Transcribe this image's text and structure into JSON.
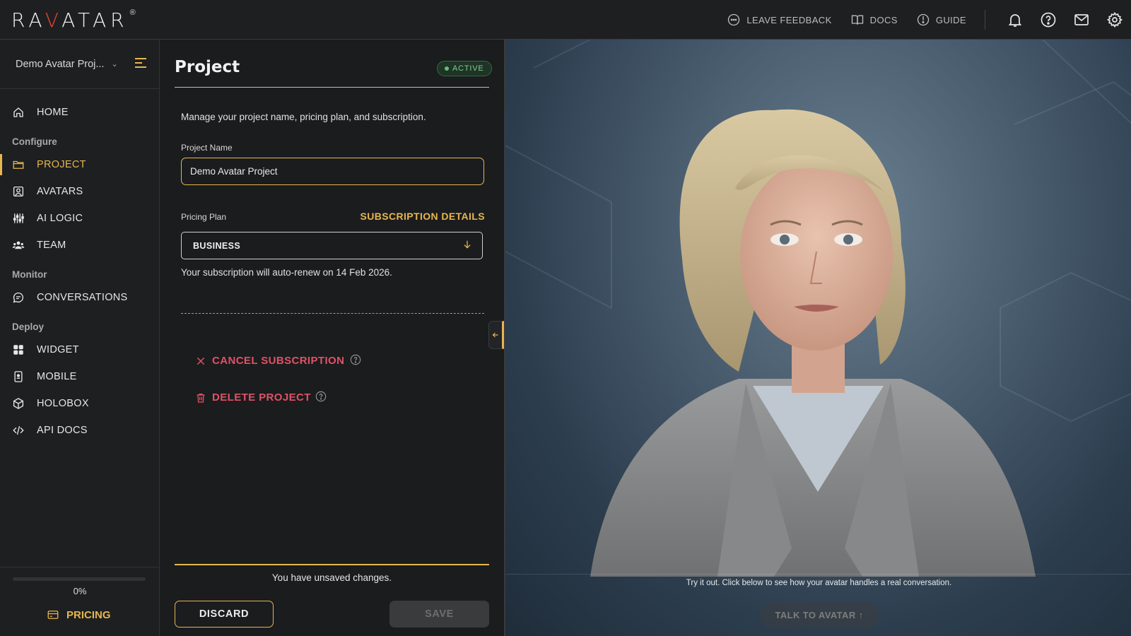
{
  "brand": {
    "logo_text_left": "RA",
    "logo_text_accent": "V",
    "logo_text_mid": "ATAR",
    "logo_reg": "®"
  },
  "topbar": {
    "leave_feedback": "LEAVE FEEDBACK",
    "docs": "DOCS",
    "guide": "GUIDE"
  },
  "sidebar": {
    "project_name": "Demo Avatar Proj...",
    "nav": {
      "home": "HOME",
      "section_configure": "Configure",
      "project": "PROJECT",
      "avatars": "AVATARS",
      "ai_logic": "AI LOGIC",
      "team": "TEAM",
      "section_monitor": "Monitor",
      "conversations": "CONVERSATIONS",
      "section_deploy": "Deploy",
      "widget": "WIDGET",
      "mobile": "MOBILE",
      "holobox": "HOLOBOX",
      "api_docs": "API DOCS"
    },
    "progress_value": 0,
    "progress_label": "0%",
    "pricing": "PRICING"
  },
  "panel": {
    "title": "Project",
    "status_badge": "ACTIVE",
    "description": "Manage your project name, pricing plan, and subscription.",
    "project_name_label": "Project Name",
    "project_name_value": "Demo Avatar Project",
    "pricing_plan_label": "Pricing Plan",
    "subscription_details": "SUBSCRIPTION DETAILS",
    "plan_value": "BUSINESS",
    "renew_text": "Your subscription will auto-renew on 14 Feb 2026.",
    "cancel_subscription": "CANCEL SUBSCRIPTION",
    "delete_project": "DELETE PROJECT",
    "unsaved_text": "You have unsaved changes.",
    "discard": "DISCARD",
    "save": "SAVE"
  },
  "preview": {
    "hint": "Try it out. Click below to see how your avatar handles a real conversation.",
    "talk_button": "TALK TO AVATAR ↑"
  },
  "colors": {
    "accent": "#e5b74e",
    "danger": "#e05265",
    "active_green": "#58c46f",
    "logo_red": "#e8432e"
  },
  "icons": [
    "feedback-icon",
    "book-icon",
    "compass-icon",
    "bell-icon",
    "help-icon",
    "mail-icon",
    "gear-icon",
    "home-icon",
    "folder-icon",
    "avatar-icon",
    "sliders-icon",
    "team-icon",
    "chat-icon",
    "grid-icon",
    "mobile-icon",
    "cube-icon",
    "code-icon",
    "card-icon",
    "close-icon",
    "trash-icon",
    "question-icon",
    "arrow-down-icon",
    "chevron-left-icon"
  ]
}
